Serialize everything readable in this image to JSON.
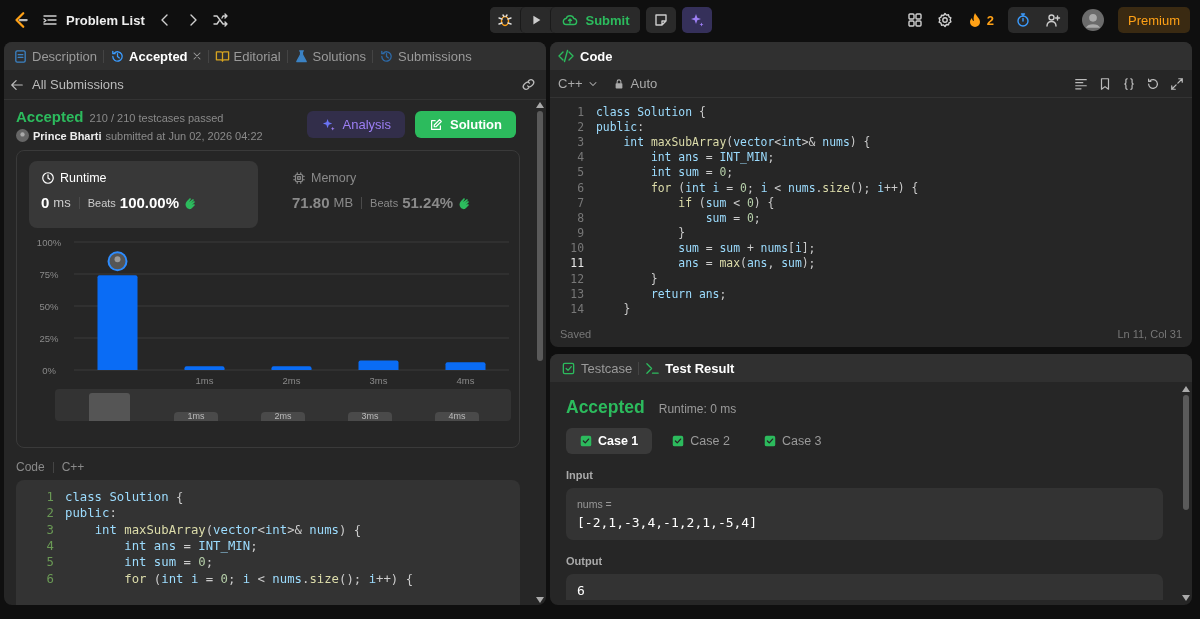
{
  "topbar": {
    "title": "Problem List",
    "submit": "Submit",
    "streak": "2",
    "premium": "Premium"
  },
  "left_tabs": [
    {
      "label": "Description",
      "selected": false,
      "closable": false
    },
    {
      "label": "Accepted",
      "selected": true,
      "closable": true
    },
    {
      "label": "Editorial",
      "selected": false,
      "closable": false
    },
    {
      "label": "Solutions",
      "selected": false,
      "closable": false
    },
    {
      "label": "Submissions",
      "selected": false,
      "closable": false
    }
  ],
  "back_link": "All Submissions",
  "submission": {
    "status": "Accepted",
    "testcases": "210 / 210 testcases passed",
    "author": "Prince Bharti",
    "submitted": "submitted at Jun 02, 2026 04:22",
    "analysis": "Analysis",
    "solution": "Solution"
  },
  "stats": [
    {
      "label": "Runtime",
      "value": "0",
      "unit": "ms",
      "beats_label": "Beats",
      "beats": "100.00%",
      "selected": true
    },
    {
      "label": "Memory",
      "value": "71.80",
      "unit": "MB",
      "beats_label": "Beats",
      "beats": "51.24%",
      "selected": false
    }
  ],
  "chart_data": {
    "type": "bar",
    "grid": true,
    "x": [
      0,
      1,
      2,
      3,
      4
    ],
    "xlim": [
      -0.5,
      4.5
    ],
    "ylim": [
      0,
      100
    ],
    "yticks": [
      {
        "value": 0,
        "label": "0%"
      },
      {
        "value": 25,
        "label": "25%"
      },
      {
        "value": 50,
        "label": "50%"
      },
      {
        "value": 75,
        "label": "75%"
      },
      {
        "value": 100,
        "label": "100%"
      }
    ],
    "xticks": [
      {
        "value": 1,
        "label": "1ms"
      },
      {
        "value": 2,
        "label": "2ms"
      },
      {
        "value": 3,
        "label": "3ms"
      },
      {
        "value": 4,
        "label": "4ms"
      }
    ],
    "series": [
      {
        "color": "#0a6cf5",
        "values": [
          74,
          3,
          3,
          7.5,
          6
        ]
      }
    ]
  },
  "overview_labels": [
    "1ms",
    "2ms",
    "3ms",
    "4ms"
  ],
  "code_section": {
    "title": "Code",
    "language": "C++",
    "lines": [
      {
        "number": "1",
        "text": "class Solution {"
      },
      {
        "number": "2",
        "text": "public:"
      },
      {
        "number": "3",
        "text": "    int maxSubArray(vector<int>& nums) {"
      },
      {
        "number": "4",
        "text": "        int ans = INT_MIN;"
      },
      {
        "number": "5",
        "text": "        int sum = 0;"
      },
      {
        "number": "6",
        "text": "        for (int i = 0; i < nums.size(); i++) {"
      }
    ]
  },
  "editor": {
    "title": "Code",
    "language": "C++",
    "mode": "Auto",
    "status": "Saved",
    "cursor": "Ln 11, Col 31",
    "lines": [
      {
        "number": "1",
        "current": false,
        "text": "class Solution {"
      },
      {
        "number": "2",
        "current": false,
        "text": "public:"
      },
      {
        "number": "3",
        "current": false,
        "text": "    int maxSubArray(vector<int>& nums) {"
      },
      {
        "number": "4",
        "current": false,
        "text": "        int ans = INT_MIN;"
      },
      {
        "number": "5",
        "current": false,
        "text": "        int sum = 0;"
      },
      {
        "number": "6",
        "current": false,
        "text": "        for (int i = 0; i < nums.size(); i++) {"
      },
      {
        "number": "7",
        "current": false,
        "text": "            if (sum < 0) {"
      },
      {
        "number": "8",
        "current": false,
        "text": "                sum = 0;"
      },
      {
        "number": "9",
        "current": false,
        "text": "            }"
      },
      {
        "number": "10",
        "current": false,
        "text": "            sum = sum + nums[i];"
      },
      {
        "number": "11",
        "current": true,
        "text": "            ans = max(ans, sum);"
      },
      {
        "number": "12",
        "current": false,
        "text": "        }"
      },
      {
        "number": "13",
        "current": false,
        "text": "        return ans;"
      },
      {
        "number": "14",
        "current": false,
        "text": "    }"
      }
    ]
  },
  "result_tabs": [
    {
      "label": "Testcase",
      "selected": false
    },
    {
      "label": "Test Result",
      "selected": true
    }
  ],
  "result": {
    "status": "Accepted",
    "runtime": "Runtime: 0 ms",
    "cases": [
      {
        "label": "Case 1",
        "selected": true,
        "passed": true
      },
      {
        "label": "Case 2",
        "selected": false,
        "passed": true
      },
      {
        "label": "Case 3",
        "selected": false,
        "passed": true
      }
    ],
    "input_label": "Input",
    "inputs": [
      {
        "name": "nums =",
        "value": "[-2,1,-3,4,-1,2,1,-5,4]"
      }
    ],
    "output_label": "Output",
    "output": "6"
  }
}
